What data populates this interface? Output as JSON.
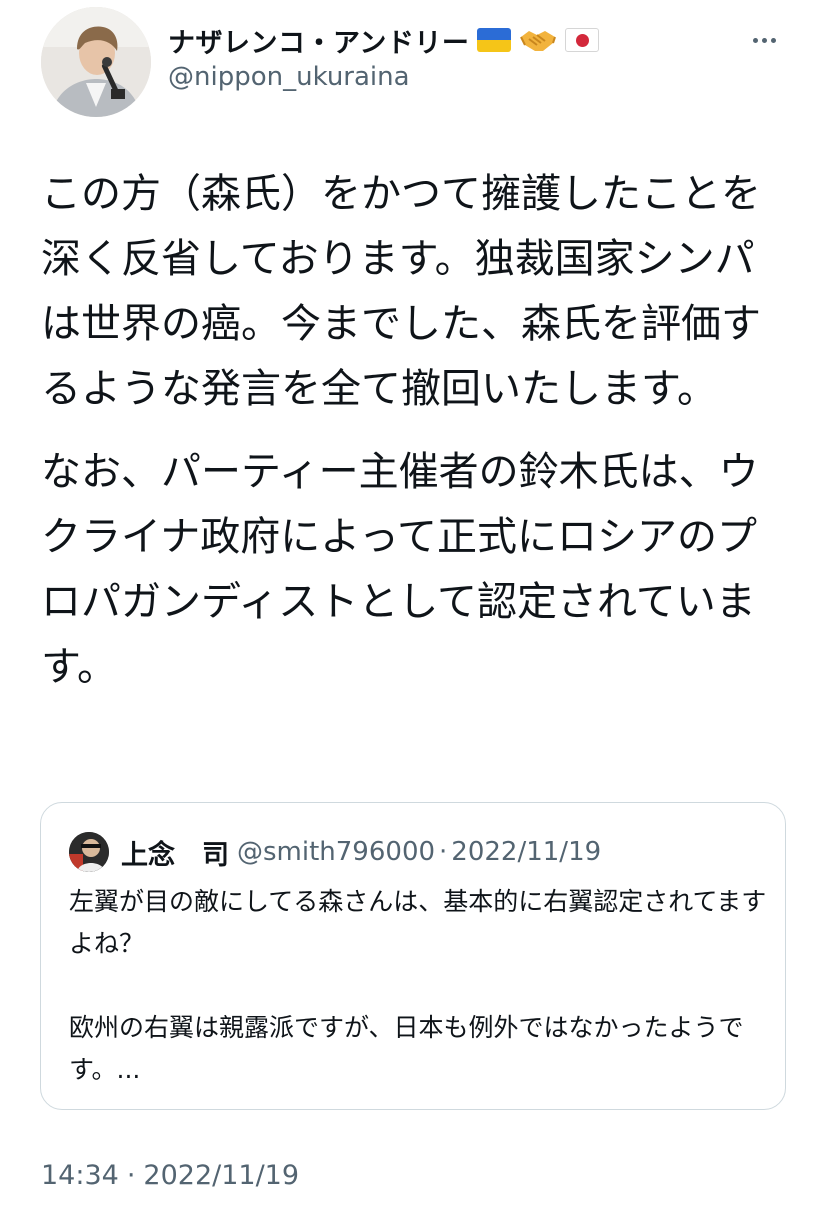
{
  "author": {
    "display_name": "ナザレンコ・アンドリー",
    "handle": "@nippon_ukuraina",
    "badges": [
      "ukraine-flag-icon",
      "handshake-icon",
      "japan-flag-icon"
    ],
    "avatar": "avatar-man-with-microphone"
  },
  "more_icon": "more-horizontal-icon",
  "tweet": {
    "paragraphs": [
      "この方（森氏）をかつて擁護したことを深く反省しております。独裁国家シンパは世界の癌。今までした、森氏を評価するような発言を全て撤回いたします。",
      "なお、パーティー主催者の鈴木氏は、ウクライナ政府によって正式にロシアのプロパガンディストとして認定されています。"
    ]
  },
  "quote": {
    "name": "上念　司",
    "handle": "@smith796000",
    "separator": "·",
    "date": "2022/11/19",
    "paragraphs": [
      "左翼が目の敵にしてる森さんは、基本的に右翼認定されてますよね？",
      "欧州の右翼は親露派ですが、日本も例外ではなかったようです。..."
    ]
  },
  "timestamp": {
    "time": "14:34",
    "separator": "·",
    "date": "2022/11/19"
  },
  "colors": {
    "text_primary": "#0f1419",
    "text_secondary": "#536471",
    "border": "#cfd9de",
    "ukraine_blue": "#2b6cd6",
    "ukraine_yellow": "#f5c518",
    "japan_red": "#d3283b"
  }
}
